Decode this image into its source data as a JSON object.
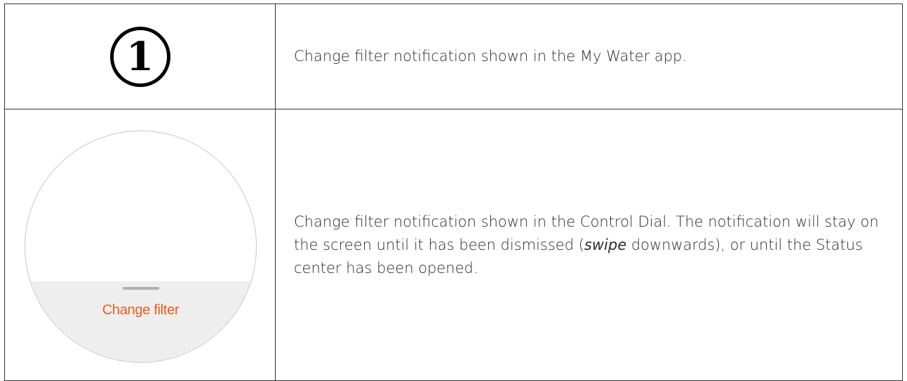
{
  "row1": {
    "step_number": "1",
    "description": "Change filter notification shown in the My Water app."
  },
  "row2": {
    "dial": {
      "notification_label": "Change filter",
      "accent_color": "#ef5d17"
    },
    "description_part1": "Change filter notification shown in the Control Dial. The notification will stay on the screen until it has been dismissed (",
    "description_emphasis": "swipe",
    "description_part2": " downwards), or until the Status center has been opened."
  }
}
